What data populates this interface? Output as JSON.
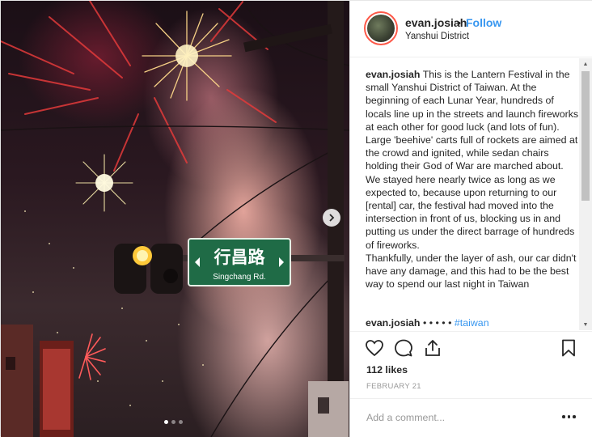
{
  "header": {
    "username": "evan.josiah",
    "separator": "•",
    "follow_label": "Follow",
    "location": "Yanshui District",
    "avatar_icon": "avatar-photo"
  },
  "photo": {
    "street_sign_text": "行昌路",
    "street_sign_romanized": "Singchang Rd.",
    "carousel_index": 1,
    "carousel_count": 3,
    "next_icon": "chevron-right-icon"
  },
  "caption": {
    "username": "evan.josiah",
    "paragraph1": "This is the Lantern Festival in the small Yanshui District of Taiwan. At the beginning of each Lunar Year, hundreds of locals line up in the streets and launch fireworks at each other for good luck (and lots of fun). Large 'beehive' carts full of rockets are aimed at the crowd and ignited, while sedan chairs holding their God of War are marched about.",
    "paragraph2": "We stayed here nearly twice as long as we expected to, because upon returning to our [rental] car, the festival had moved into the intersection in front of us, blocking us in and putting us under the direct barrage of hundreds of fireworks.",
    "paragraph3": "Thankfully, under the layer of ash, our car didn't have any damage, and this had to be the best way to spend our last night in Taiwan"
  },
  "comment": {
    "username": "evan.josiah",
    "dots": "• • • • •",
    "hashtag": "#taiwan"
  },
  "actions": {
    "icons": [
      "heart-icon",
      "comment-icon",
      "share-icon",
      "bookmark-icon"
    ]
  },
  "likes_text": "112 likes",
  "date_text": "FEBRUARY 21",
  "add_comment": {
    "placeholder": "Add a comment...",
    "more_icon": "more-options-icon"
  },
  "colors": {
    "link_blue": "#3897f0",
    "text": "#262626",
    "muted": "#999999"
  }
}
